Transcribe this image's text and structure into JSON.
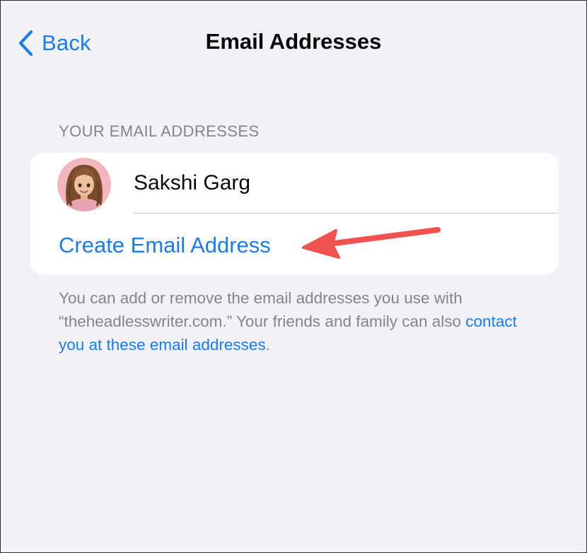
{
  "nav": {
    "back_label": "Back",
    "title": "Email Addresses"
  },
  "section": {
    "header": "YOUR EMAIL ADDRESSES"
  },
  "account": {
    "name": "Sakshi Garg",
    "avatar_icon": "memoji-avatar-icon"
  },
  "actions": {
    "create_email": "Create Email Address"
  },
  "footer": {
    "text_before_link": "You can add or remove the email addresses you use with “theheadlesswriter.com.” Your friends and family can also ",
    "link_text": "contact you at these email addresses",
    "text_after_link": "."
  },
  "colors": {
    "accent": "#1a7bf2",
    "background": "#f2f1f6",
    "card": "#ffffff",
    "secondary_text": "#85848a",
    "annotation_arrow": "#ef5350"
  }
}
